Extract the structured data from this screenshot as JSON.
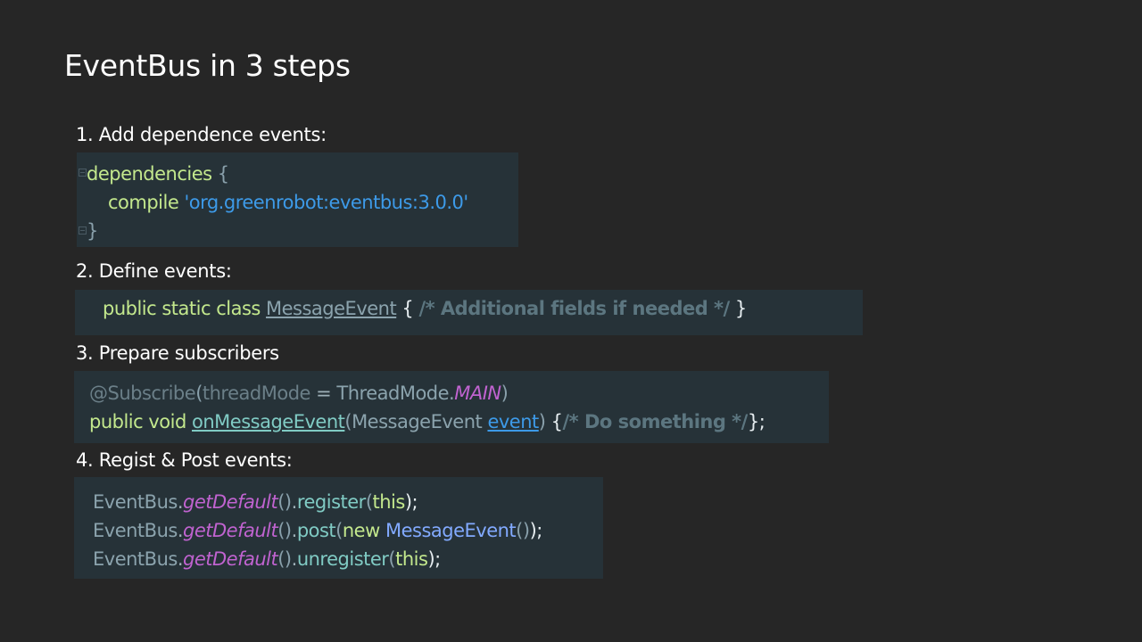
{
  "slide": {
    "title": "EventBus in 3 steps"
  },
  "steps": [
    {
      "heading": "1. Add dependence events:",
      "code": {
        "line1": {
          "kw": "dependencies",
          "brace": " {"
        },
        "line2": {
          "kw": "compile",
          "str": "'org.greenrobot:eventbus:3.0.0'"
        },
        "line3": {
          "brace": "}"
        }
      }
    },
    {
      "heading": "2. Define events:",
      "code": {
        "line1": {
          "kw": "public static class",
          "type": "MessageEvent",
          "open": "{",
          "comment": "/* Additional fields if needed */",
          "close": "}"
        }
      }
    },
    {
      "heading": "3. Prepare subscribers",
      "code": {
        "line1": {
          "anno": "@Subscribe",
          "open": "(",
          "param": "threadMode",
          "eq": " = ",
          "type": "ThreadMode.",
          "const": "MAIN",
          "close": ")"
        },
        "line2": {
          "kw": "public void",
          "method": "onMessageEvent",
          "open": "(",
          "type": "MessageEvent",
          "var": "event",
          "close": ")",
          "body_open": " {",
          "comment": "/* Do something */",
          "body_close": "};"
        }
      }
    },
    {
      "heading": "4. Regist & Post events:",
      "code": {
        "lines": [
          {
            "cls": "EventBus",
            "dot": ".",
            "m": "getDefault",
            "paren": "()",
            "dot2": ".",
            "call": "register",
            "open": "(",
            "arg_kw": "this",
            "arg_cls": "",
            "arg_paren": "",
            "close": ");"
          },
          {
            "cls": "EventBus",
            "dot": ".",
            "m": "getDefault",
            "paren": "()",
            "dot2": ".",
            "call": "post",
            "open": "(",
            "arg_kw": "new ",
            "arg_cls": "MessageEvent",
            "arg_paren": "()",
            "close": ");"
          },
          {
            "cls": "EventBus",
            "dot": ".",
            "m": "getDefault",
            "paren": "()",
            "dot2": ".",
            "call": "unregister",
            "open": "(",
            "arg_kw": "this",
            "arg_cls": "",
            "arg_paren": "",
            "close": ");"
          }
        ]
      }
    }
  ]
}
